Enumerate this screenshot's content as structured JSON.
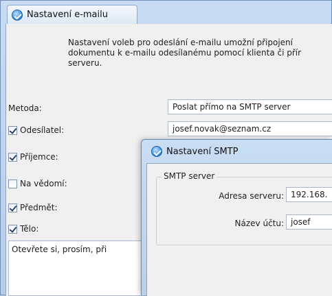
{
  "main_window": {
    "title": "Nastavení e-mailu",
    "description_lines": [
      "Nastavení voleb pro odeslání e-mailu umožní připojení",
      "dokumentu k e-mailu odesílanému pomocí klienta či přír",
      "serveru."
    ],
    "method": {
      "label": "Metoda:",
      "value": "Poslat přímo na SMTP server"
    },
    "sender": {
      "label": "Odesílatel:",
      "checked": true,
      "value": "josef.novak@seznam.cz"
    },
    "recipients": {
      "label": "Příjemce:",
      "checked": true
    },
    "cc": {
      "label": "Na vědomí:",
      "checked": false
    },
    "subject": {
      "label": "Předmět:",
      "checked": true
    },
    "body": {
      "label": "Tělo:",
      "checked": true,
      "value": "Otevřete si, prosím, při"
    }
  },
  "smtp_dialog": {
    "title": "Nastavení SMTP",
    "group_label": "SMTP server",
    "server_address": {
      "label": "Adresa serveru:",
      "value": "192.168."
    },
    "account_name": {
      "label": "Název účtu:",
      "value": "josef"
    }
  },
  "colors": {
    "titlebar": "#b9cfe6",
    "dialog_face": "#f0f0f0",
    "icon_blue": "#2c84d8"
  },
  "icons": {
    "app": "app-check-icon"
  }
}
